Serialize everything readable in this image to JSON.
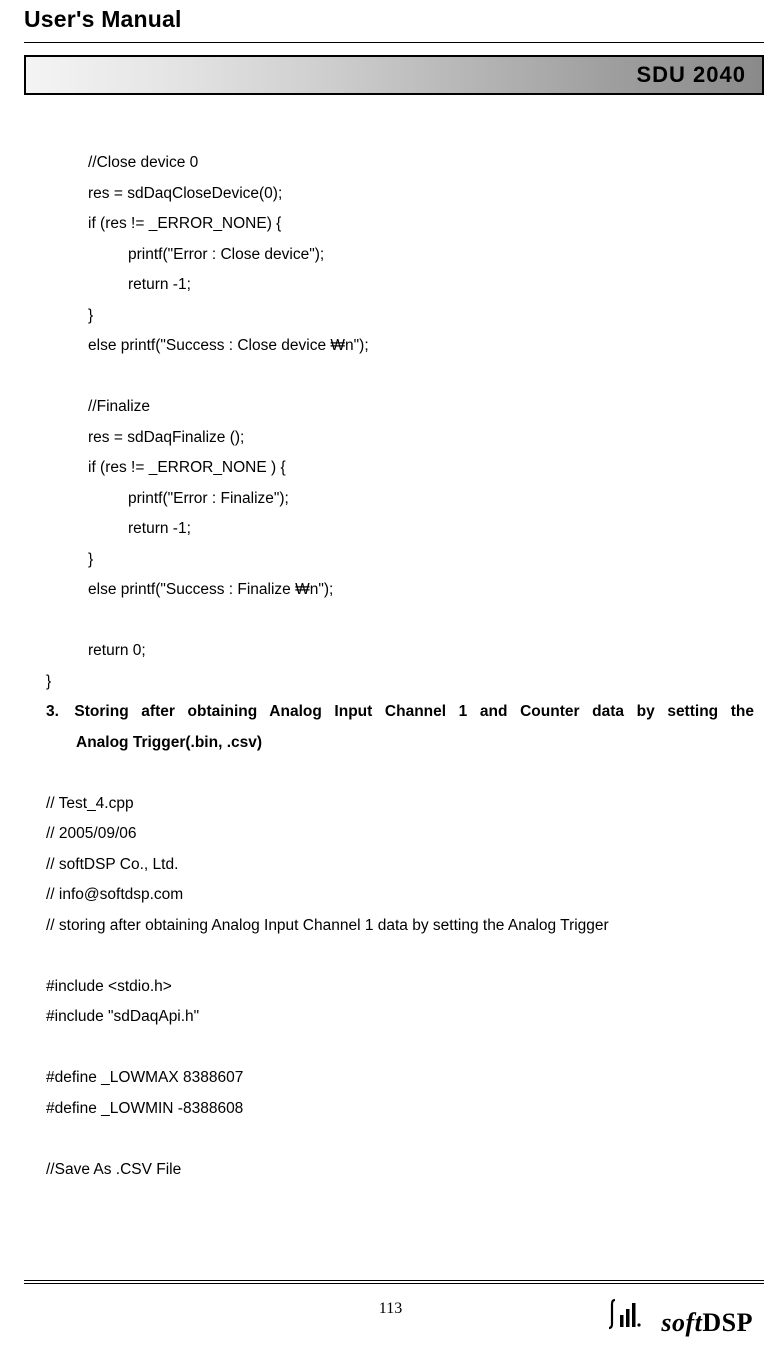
{
  "header": {
    "title": "User's Manual",
    "banner": "SDU 2040"
  },
  "code": {
    "c01": "//Close device 0",
    "c02": "res = sdDaqCloseDevice(0);",
    "c03": "if (res != _ERROR_NONE) {",
    "c04": "printf(\"Error : Close device\");",
    "c05": "return -1;",
    "c06": "}",
    "c07": "else printf(\"Success : Close device ₩n\");",
    "c08": "//Finalize",
    "c09": "res = sdDaqFinalize ();",
    "c10": "if (res != _ERROR_NONE ) {",
    "c11": "printf(\"Error : Finalize\");",
    "c12": "return -1;",
    "c13": "}",
    "c14": "else printf(\"Success : Finalize ₩n\");",
    "c15": "return 0;",
    "c16": "}"
  },
  "section": {
    "line1": "3. Storing after obtaining Analog Input Channel 1 and Counter data by setting the",
    "line2": "Analog Trigger(.bin, .csv)"
  },
  "code2": {
    "d01": "// Test_4.cpp",
    "d02": "// 2005/09/06",
    "d03": "// softDSP Co., Ltd.",
    "d04": "// info@softdsp.com",
    "d05": "// storing after obtaining Analog Input Channel 1 data by setting the Analog Trigger",
    "d06": "#include <stdio.h>",
    "d07": "#include \"sdDaqApi.h\"",
    "d08": "#define _LOWMAX 8388607",
    "d09": "#define _LOWMIN -8388608",
    "d10": "//Save As .CSV File"
  },
  "footer": {
    "pagenum": "113",
    "logo_soft": "soft",
    "logo_dsp": "DSP"
  }
}
